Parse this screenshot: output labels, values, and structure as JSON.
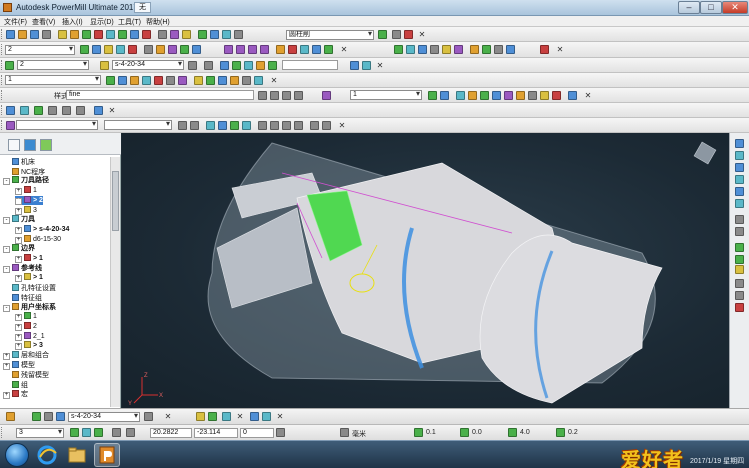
{
  "window": {
    "title": "Autodesk PowerMill Ultimate 2017",
    "doc_tab": "无"
  },
  "menu": [
    "文件(F)",
    "查看(V)",
    "插入(I)",
    "显示(D)",
    "工具(T)",
    "帮助(H)"
  ],
  "toolbar1": {
    "combo_label": "圆柱削"
  },
  "toolbar2": {
    "combo_value": "2"
  },
  "toolbar3": {
    "combo_value": "2",
    "tool_combo": "s-4-20-34"
  },
  "toolbar4": {
    "combo_value": "1"
  },
  "toolbar5": {
    "style_label": "样式",
    "style_value": "fine",
    "combo_value": "1"
  },
  "explorer": {
    "tree": [
      {
        "label": "机床",
        "indent": 0,
        "expander": "",
        "bold": false
      },
      {
        "label": "NC程序",
        "indent": 0,
        "expander": "",
        "bold": false
      },
      {
        "label": "刀具路径",
        "indent": 0,
        "expander": "-",
        "bold": true
      },
      {
        "label": "1",
        "indent": 1,
        "expander": "+",
        "bold": false
      },
      {
        "label": "> 2",
        "indent": 1,
        "expander": "+",
        "bold": true,
        "selected": true
      },
      {
        "label": "3",
        "indent": 1,
        "expander": "+",
        "bold": false
      },
      {
        "label": "刀具",
        "indent": 0,
        "expander": "-",
        "bold": true
      },
      {
        "label": "> s-4-20-34",
        "indent": 1,
        "expander": "+",
        "bold": true
      },
      {
        "label": "d6-15-30",
        "indent": 1,
        "expander": "+",
        "bold": false
      },
      {
        "label": "边界",
        "indent": 0,
        "expander": "-",
        "bold": true
      },
      {
        "label": "> 1",
        "indent": 1,
        "expander": "+",
        "bold": true
      },
      {
        "label": "参考线",
        "indent": 0,
        "expander": "-",
        "bold": true
      },
      {
        "label": "> 1",
        "indent": 1,
        "expander": "+",
        "bold": true
      },
      {
        "label": "孔特征设置",
        "indent": 0,
        "expander": "",
        "bold": false
      },
      {
        "label": "特征组",
        "indent": 0,
        "expander": "",
        "bold": false
      },
      {
        "label": "用户坐标系",
        "indent": 0,
        "expander": "-",
        "bold": true
      },
      {
        "label": "1",
        "indent": 1,
        "expander": "+",
        "bold": false
      },
      {
        "label": "2",
        "indent": 1,
        "expander": "+",
        "bold": false
      },
      {
        "label": "2_1",
        "indent": 1,
        "expander": "+",
        "bold": false
      },
      {
        "label": "> 3",
        "indent": 1,
        "expander": "+",
        "bold": true
      },
      {
        "label": "层和组合",
        "indent": 0,
        "expander": "+",
        "bold": false
      },
      {
        "label": "模型",
        "indent": 0,
        "expander": "+",
        "bold": false
      },
      {
        "label": "残留模型",
        "indent": 0,
        "expander": "",
        "bold": false
      },
      {
        "label": "组",
        "indent": 0,
        "expander": "",
        "bold": false
      },
      {
        "label": "宏",
        "indent": 0,
        "expander": "+",
        "bold": false
      }
    ]
  },
  "viewport": {
    "axis_labels": {
      "x": "X",
      "y": "Y",
      "z": "Z"
    }
  },
  "status1": {
    "tool_combo": "s-4-20-34"
  },
  "status2": {
    "combo_value": "3",
    "coord_x": "20.2822",
    "coord_y": "-23.114",
    "coord_z": "0",
    "unit": "毫米",
    "val1": "0.1",
    "val2": "0.0",
    "val3": "4.0",
    "val4": "0.2"
  },
  "taskbar": {
    "watermark": "爱好者",
    "clock": "2017/1/19 星期四"
  },
  "colors": {
    "viewport_bg": "#1c2a35",
    "stock": "#aab6c4",
    "model": "#d8d8dc",
    "toolpath_blue": "#3d8fe0",
    "green_surface": "#38d838",
    "yellow_tool": "#e8e010"
  }
}
